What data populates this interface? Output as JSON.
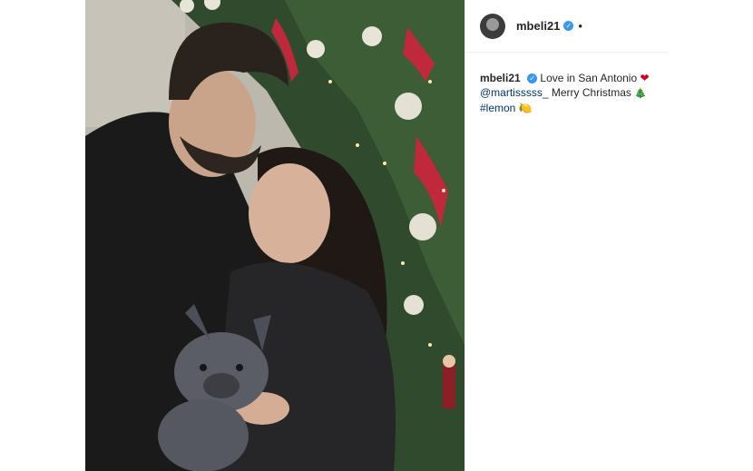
{
  "post": {
    "username": "mbeli21",
    "verified_icon": "verified-badge-icon",
    "header_separator": "•",
    "caption": {
      "username": "mbeli21",
      "text_1": "Love in San Antonio",
      "emoji_1": "❤",
      "mention": "@martisssss_",
      "text_2": "Merry Christmas",
      "emoji_2": "🎄",
      "hashtag": "#lemon",
      "emoji_3": "🍋"
    }
  },
  "colors": {
    "username": "#262626",
    "link": "#003569",
    "verified": "#3897f0",
    "border": "#efefef"
  }
}
